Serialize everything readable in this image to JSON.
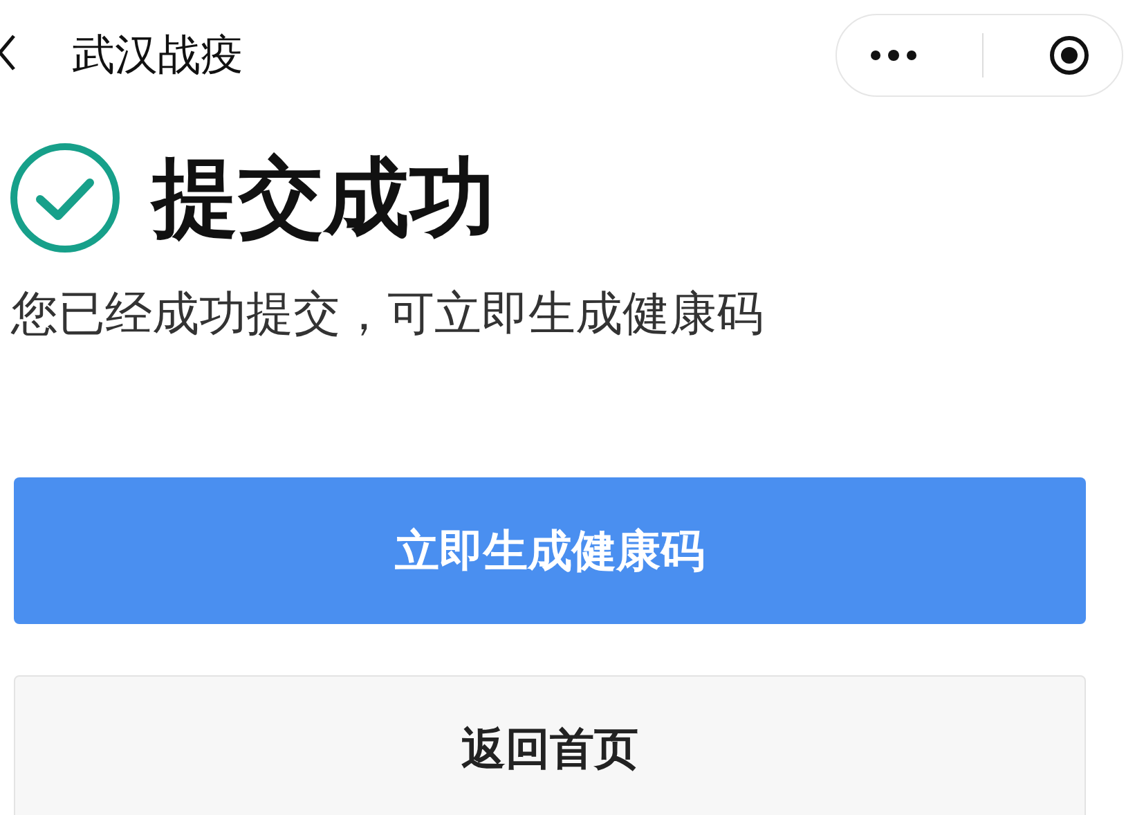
{
  "nav": {
    "title": "武汉战疫"
  },
  "result": {
    "title": "提交成功",
    "message": "您已经成功提交，可立即生成健康码"
  },
  "buttons": [
    {
      "label": "立即生成健康码",
      "kind": "primary"
    },
    {
      "label": "返回首页",
      "kind": "secondary"
    }
  ]
}
